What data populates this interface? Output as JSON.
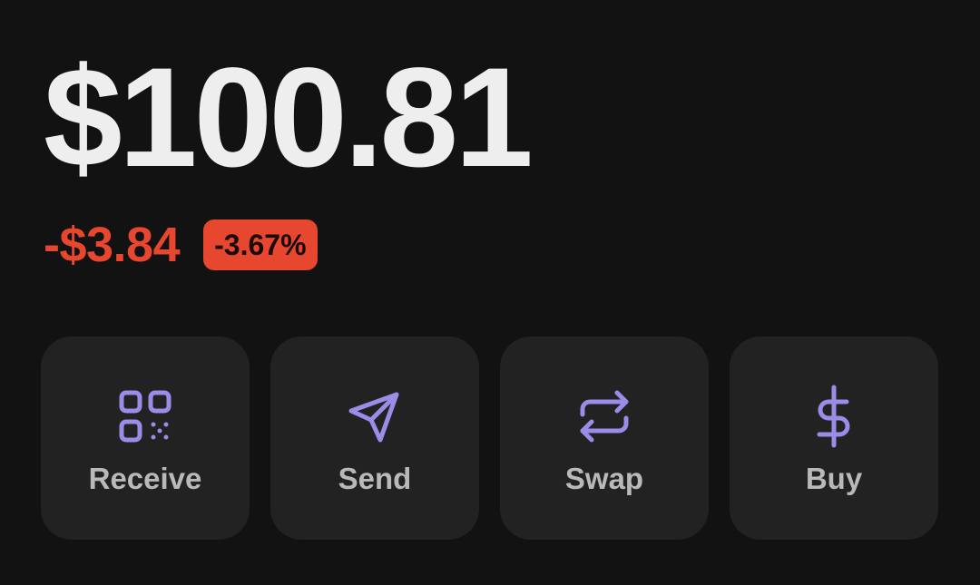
{
  "balance": {
    "amount": "$100.81",
    "change_amount": "-$3.84",
    "change_percent": "-3.67%"
  },
  "colors": {
    "background": "#121212",
    "card": "#222222",
    "negative": "#e8472f",
    "icon_accent": "#9b8ce8",
    "label": "#b9b9b9"
  },
  "actions": [
    {
      "label": "Receive",
      "icon": "qr-code-icon"
    },
    {
      "label": "Send",
      "icon": "send-icon"
    },
    {
      "label": "Swap",
      "icon": "swap-icon"
    },
    {
      "label": "Buy",
      "icon": "dollar-icon"
    }
  ]
}
